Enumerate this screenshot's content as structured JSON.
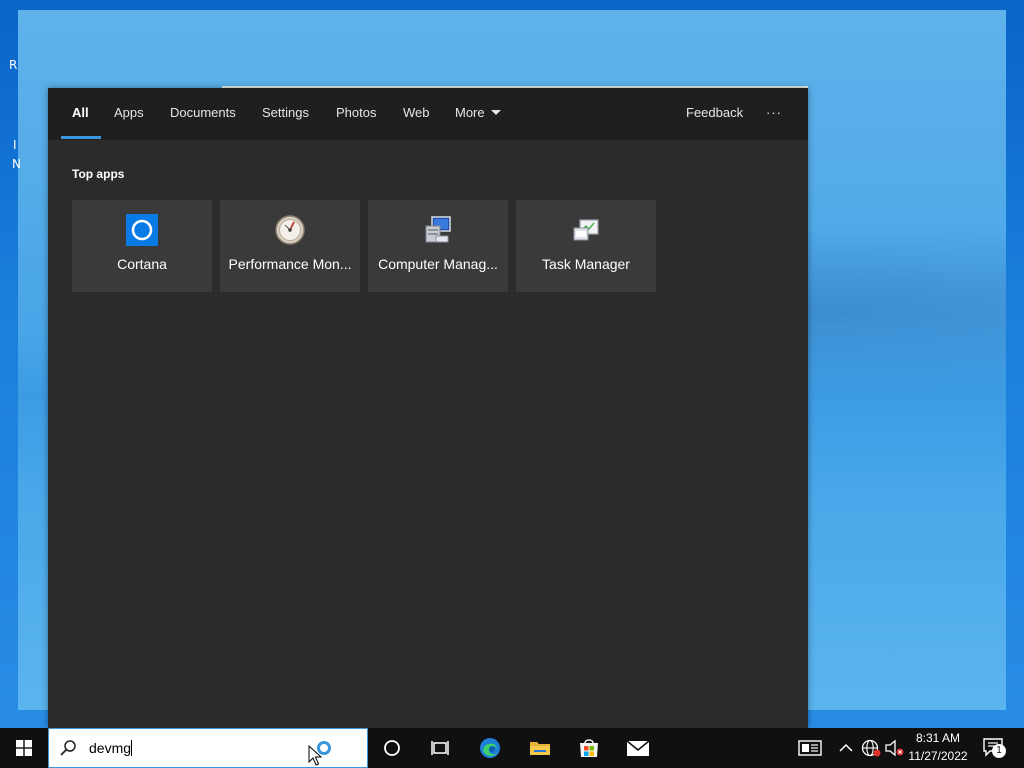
{
  "search_panel": {
    "tabs": [
      {
        "label": "All"
      },
      {
        "label": "Apps"
      },
      {
        "label": "Documents"
      },
      {
        "label": "Settings"
      },
      {
        "label": "Photos"
      },
      {
        "label": "Web"
      },
      {
        "label": "More"
      }
    ],
    "feedback_label": "Feedback",
    "more_options_label": "···",
    "section_title": "Top apps",
    "top_apps": [
      {
        "label": "Cortana",
        "icon": "cortana-icon"
      },
      {
        "label": "Performance Mon...",
        "icon": "performance-monitor-icon"
      },
      {
        "label": "Computer Manag...",
        "icon": "computer-management-icon"
      },
      {
        "label": "Task Manager",
        "icon": "task-manager-icon"
      }
    ]
  },
  "taskbar": {
    "search_query": "devmg",
    "pinned": [
      "task-view-icon",
      "edge-icon",
      "file-explorer-icon",
      "store-icon",
      "mail-icon"
    ],
    "tray": {
      "time": "8:31 AM",
      "date": "11/27/2022",
      "notification_count": "1"
    }
  },
  "desktop_fragments": [
    "R",
    "I",
    "N"
  ],
  "colors": {
    "accent": "#3a96dd",
    "panel_bg": "#2b2b2b",
    "tab_bar_bg": "#1f1f1f",
    "tile_bg": "#3a3a3a",
    "taskbar_bg": "#101010"
  }
}
